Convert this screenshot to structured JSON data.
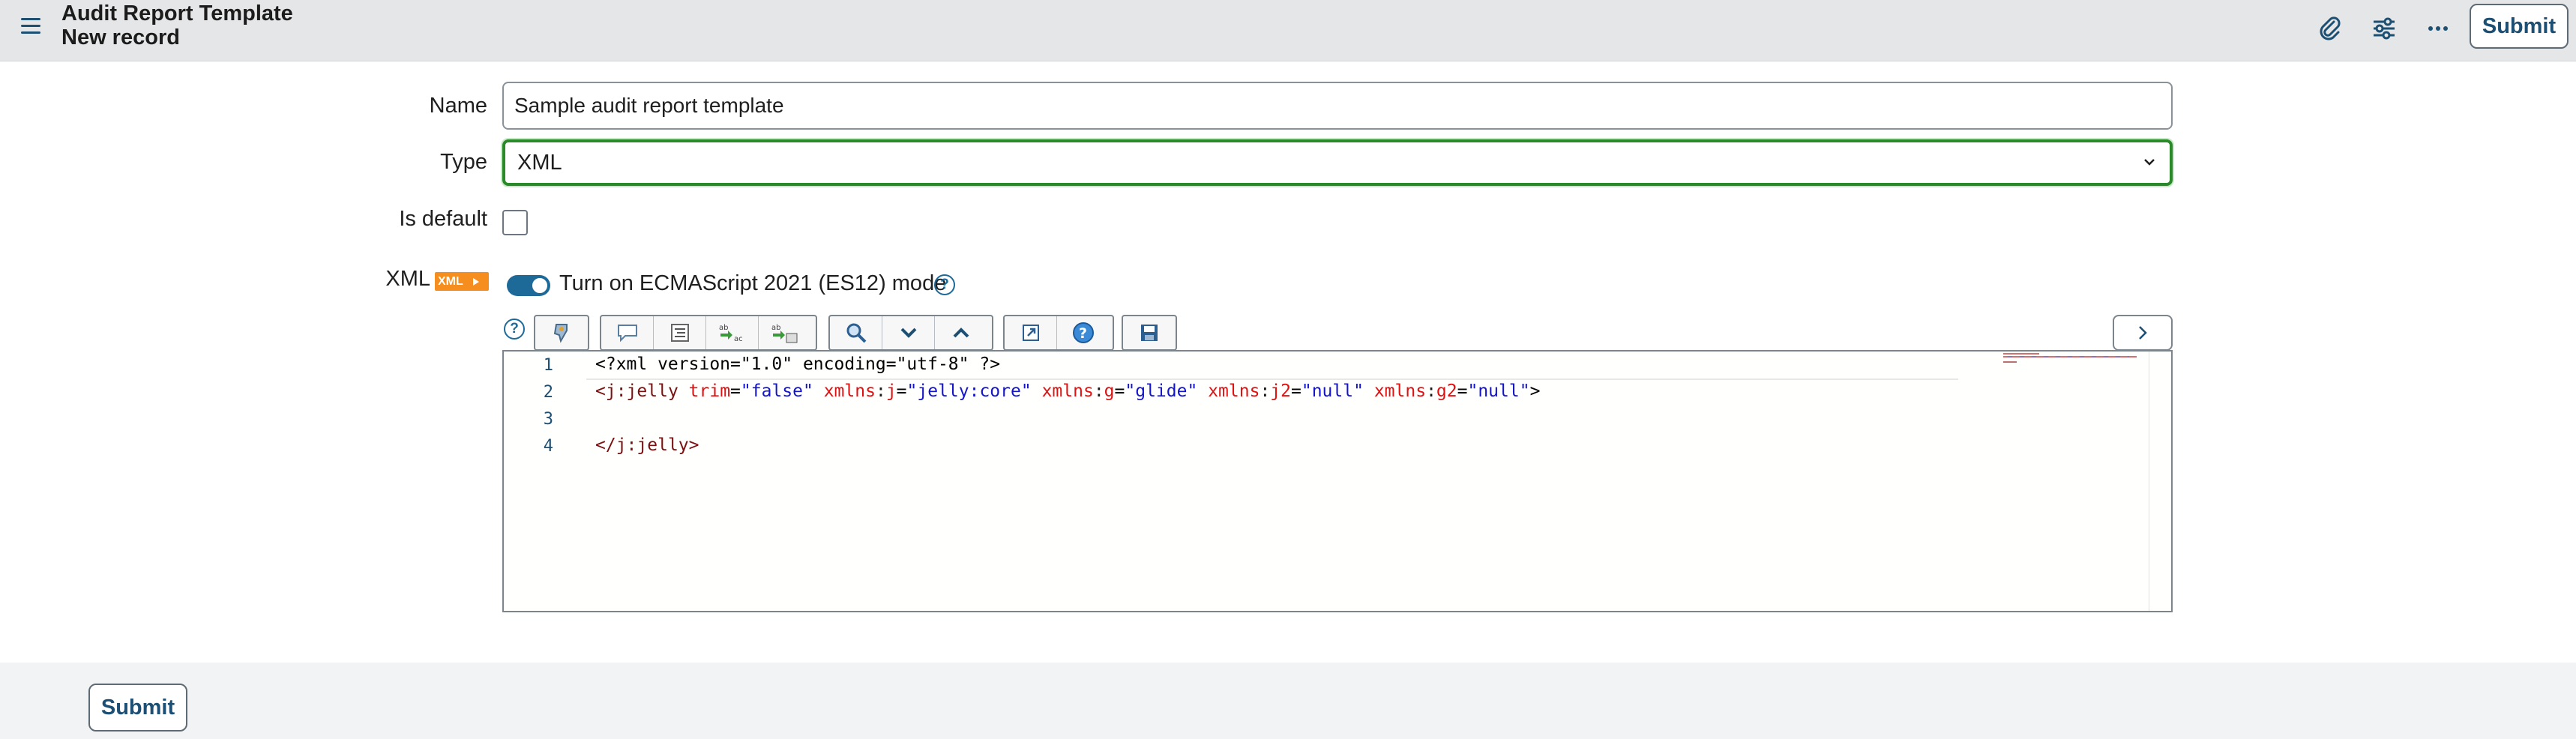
{
  "header": {
    "title": "Audit Report Template",
    "subtitle": "New record",
    "submit_label": "Submit",
    "icons": [
      "paperclip-icon",
      "sliders-icon",
      "more-icon"
    ]
  },
  "form": {
    "name_label": "Name",
    "name_value": "Sample audit report template",
    "type_label": "Type",
    "type_value": "XML",
    "is_default_label": "Is default",
    "is_default_checked": false,
    "xml_label": "XML",
    "xml_badge": "XML",
    "es12_toggle_label": "Turn on ECMAScript 2021 (ES12) mode",
    "es12_enabled": true
  },
  "editor": {
    "line_numbers": [
      "1",
      "2",
      "3",
      "4"
    ],
    "lines": [
      "<?xml version=\"1.0\" encoding=\"utf-8\" ?>",
      "<j:jelly trim=\"false\" xmlns:j=\"jelly:core\" xmlns:g=\"glide\" xmlns:j2=\"null\" xmlns:g2=\"null\">",
      "",
      "</j:jelly>"
    ],
    "tokens": {
      "l1": "<?xml version=\"1.0\" encoding=\"utf-8\" ?>",
      "open_bracket": "<",
      "tag_jelly": "j:jelly",
      "attr_trim": "trim",
      "eq": "=",
      "val_false": "\"false\"",
      "attr_xmlns1": "xmlns",
      "colon": ":",
      "ns_j": "j",
      "val_core": "\"jelly:core\"",
      "attr_xmlns2": "xmlns",
      "ns_g": "g",
      "val_glide": "\"glide\"",
      "attr_xmlns3": "xmlns",
      "ns_j2": "j2",
      "val_null1": "\"null\"",
      "attr_xmlns4": "xmlns",
      "ns_g2": "g2",
      "val_null2": "\"null\"",
      "close_bracket": ">",
      "close_open": "</",
      "close_tag": "j:jelly",
      "close_end": ">"
    },
    "toolbar_icons": [
      "format-code-icon",
      "comment-icon",
      "outline-icon",
      "replace-icon",
      "replace-all-icon",
      "search-icon",
      "find-next-icon",
      "find-previous-icon",
      "fullscreen-icon",
      "help-icon",
      "save-icon",
      "expand-panel-icon"
    ]
  },
  "footer": {
    "submit_label": "Submit"
  },
  "colors": {
    "accent": "#1d4f73",
    "select_border": "#2a8a2a",
    "badge": "#f58d1f"
  }
}
